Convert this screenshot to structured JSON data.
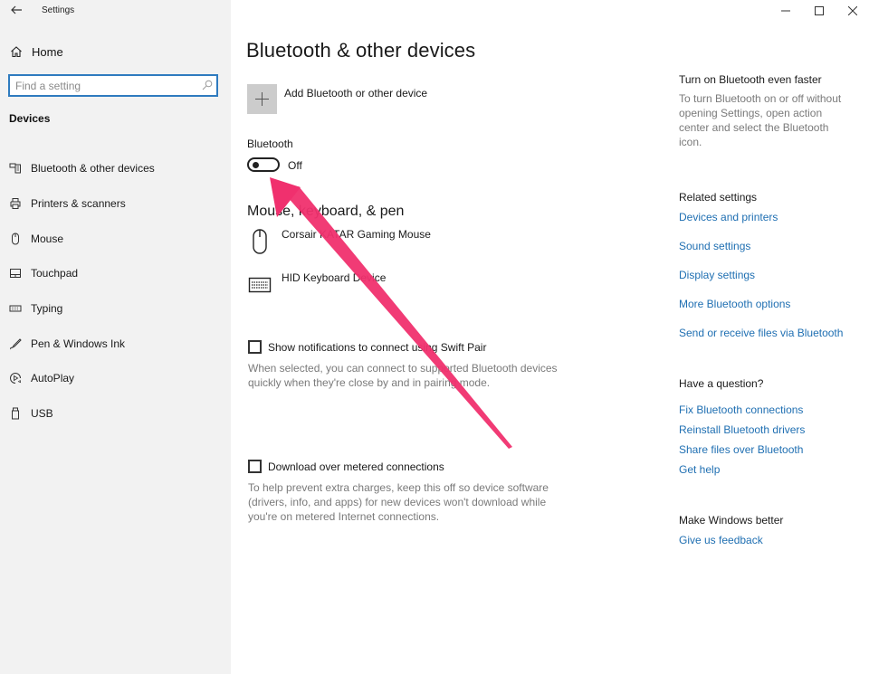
{
  "window": {
    "app_title": "Settings",
    "controls": {
      "minimize": "minimize-icon",
      "maximize": "maximize-icon",
      "close": "close-icon"
    }
  },
  "sidebar": {
    "home_label": "Home",
    "search_placeholder": "Find a setting",
    "search_value": "",
    "section_label": "Devices",
    "items": [
      {
        "label": "Bluetooth & other devices",
        "icon": "bluetooth-devices-icon",
        "selected": true
      },
      {
        "label": "Printers & scanners",
        "icon": "printer-icon"
      },
      {
        "label": "Mouse",
        "icon": "mouse-icon"
      },
      {
        "label": "Touchpad",
        "icon": "touchpad-icon"
      },
      {
        "label": "Typing",
        "icon": "keyboard-icon"
      },
      {
        "label": "Pen & Windows Ink",
        "icon": "pen-icon"
      },
      {
        "label": "AutoPlay",
        "icon": "autoplay-icon"
      },
      {
        "label": "USB",
        "icon": "usb-icon"
      }
    ]
  },
  "main": {
    "title": "Bluetooth & other devices",
    "add_device_label": "Add Bluetooth or other device",
    "bluetooth": {
      "label": "Bluetooth",
      "state_label": "Off",
      "on": false
    },
    "peripherals_heading": "Mouse, keyboard, & pen",
    "devices": [
      {
        "name": "Corsair KATAR Gaming Mouse",
        "icon": "mouse-icon"
      },
      {
        "name": "HID Keyboard Device",
        "icon": "keyboard-icon"
      }
    ],
    "swift_pair": {
      "label": "Show notifications to connect using Swift Pair",
      "checked": false,
      "description_line1": "When selected, you can connect to supported Bluetooth devices",
      "description_line2": "quickly when they're close by and in pairing mode."
    },
    "metered": {
      "label": "Download over metered connections",
      "checked": false,
      "description_line1": "To help prevent extra charges, keep this off so device software",
      "description_line2": "(drivers, info, and apps) for new devices won't download while",
      "description_line3": "you're on metered Internet connections."
    }
  },
  "right_column": {
    "tip": {
      "heading": "Turn on Bluetooth even faster",
      "lines": [
        "To turn Bluetooth on or off without",
        "opening Settings, open action",
        "center and select the Bluetooth",
        "icon."
      ]
    },
    "related": {
      "heading": "Related settings",
      "links": [
        "Devices and printers",
        "Sound settings",
        "Display settings",
        "More Bluetooth options",
        "Send or receive files via Bluetooth"
      ]
    },
    "question": {
      "heading": "Have a question?",
      "links": [
        "Fix Bluetooth connections",
        "Reinstall Bluetooth drivers",
        "Share files over Bluetooth",
        "Get help"
      ]
    },
    "feedback": {
      "heading": "Make Windows better",
      "link": "Give us feedback"
    }
  },
  "annotation": {
    "type": "arrow",
    "color": "#f0306e",
    "points_to": "bluetooth-toggle"
  }
}
